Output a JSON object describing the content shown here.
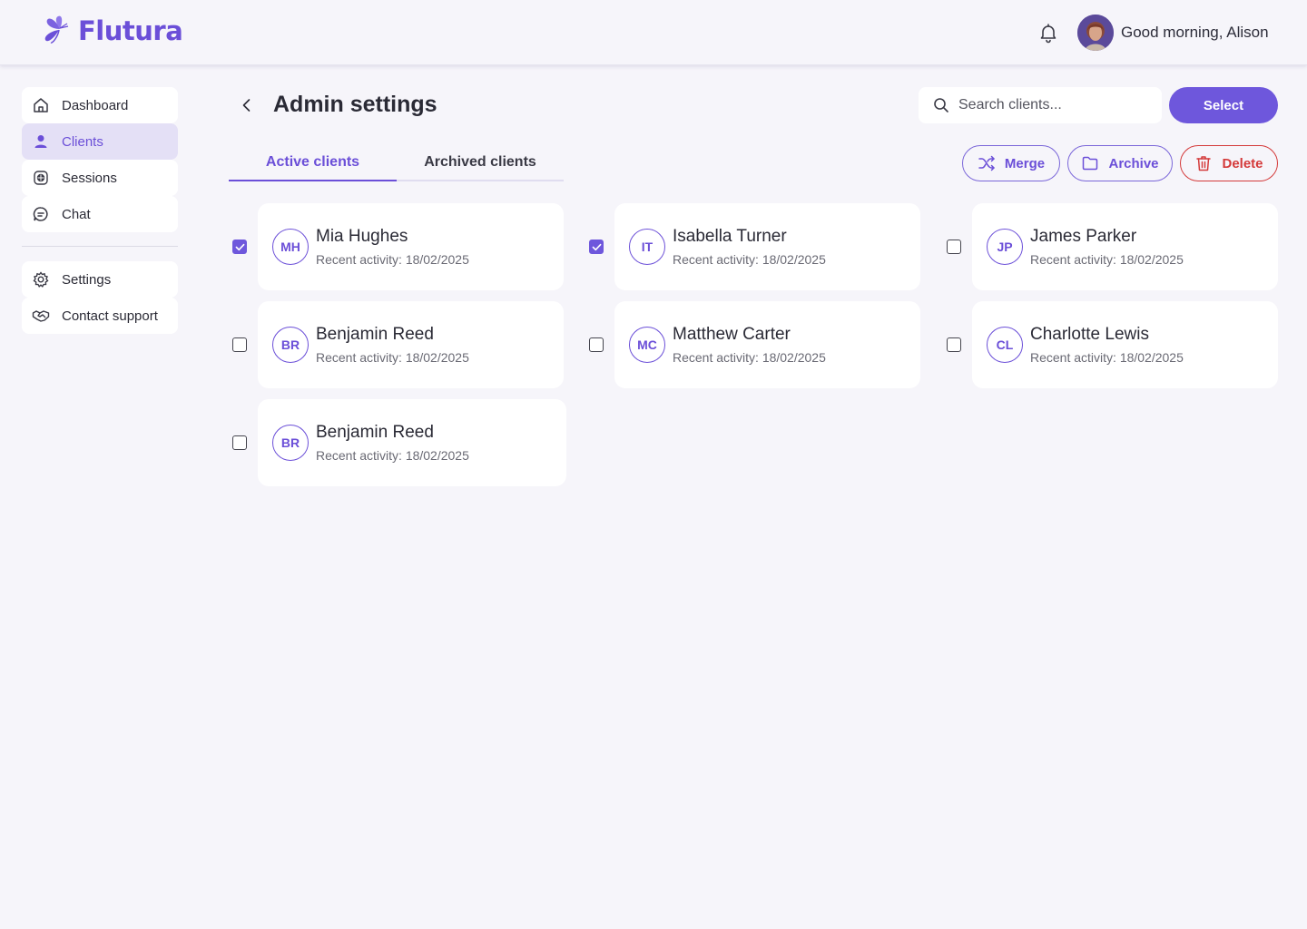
{
  "brand": {
    "name": "Flutura",
    "accent": "#6b4fd8"
  },
  "header": {
    "greeting": "Good morning, Alison",
    "icons": [
      "bell-icon",
      "avatar"
    ]
  },
  "sidebar": {
    "items": [
      {
        "label": "Dashboard",
        "icon": "home-icon",
        "active": false
      },
      {
        "label": "Clients",
        "icon": "user-icon",
        "active": true
      },
      {
        "label": "Sessions",
        "icon": "sessions-icon",
        "active": false
      },
      {
        "label": "Chat",
        "icon": "chat-icon",
        "active": false
      }
    ],
    "footer_items": [
      {
        "label": "Settings",
        "icon": "gear-icon"
      },
      {
        "label": "Contact support",
        "icon": "handshake-icon"
      }
    ]
  },
  "main": {
    "title": "Admin settings",
    "search": {
      "placeholder": "Search clients..."
    },
    "select_label": "Select",
    "tabs": [
      {
        "label": "Active clients",
        "active": true
      },
      {
        "label": "Archived clients",
        "active": false
      }
    ],
    "actions": {
      "merge": "Merge",
      "archive": "Archive",
      "delete": "Delete"
    },
    "delete_color": "#d43a3a",
    "clients": [
      {
        "initials": "MH",
        "name": "Mia Hughes",
        "activity": "Recent activity: 18/02/2025",
        "checked": true
      },
      {
        "initials": "IT",
        "name": "Isabella Turner",
        "activity": "Recent activity: 18/02/2025",
        "checked": true
      },
      {
        "initials": "JP",
        "name": "James Parker",
        "activity": "Recent activity: 18/02/2025",
        "checked": false
      },
      {
        "initials": "BR",
        "name": "Benjamin Reed",
        "activity": "Recent activity: 18/02/2025",
        "checked": false
      },
      {
        "initials": "MC",
        "name": "Matthew Carter",
        "activity": "Recent activity: 18/02/2025",
        "checked": false
      },
      {
        "initials": "CL",
        "name": "Charlotte Lewis",
        "activity": "Recent activity: 18/02/2025",
        "checked": false
      },
      {
        "initials": "BR",
        "name": "Benjamin Reed",
        "activity": "Recent activity: 18/02/2025",
        "checked": false
      }
    ]
  }
}
